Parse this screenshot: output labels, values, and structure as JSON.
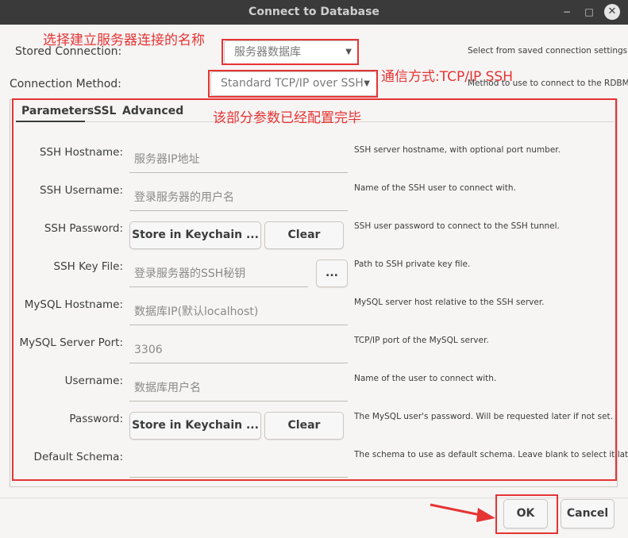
{
  "window": {
    "title": "Connect to Database",
    "minimize": "−",
    "maximize": "□",
    "close": "✕"
  },
  "stored_connection": {
    "label": "Stored Connection:",
    "value": "服务器数据库",
    "hint": "Select from saved connection settings"
  },
  "connection_method": {
    "label": "Connection Method:",
    "value": "Standard TCP/IP over SSH",
    "hint": "Method to use to connect to the RDBMS"
  },
  "annotations": {
    "name_note": "选择建立服务器连接的名称",
    "method_note": "通信方式:TCP/IP SSH",
    "params_note": "该部分参数已经配置完毕",
    "highlight_color": "#e53434"
  },
  "tabs": [
    "Parameters",
    "SSL",
    "Advanced"
  ],
  "fields": {
    "ssh_hostname": {
      "label": "SSH Hostname:",
      "value": "服务器IP地址",
      "hint": "SSH server hostname, with  optional port number."
    },
    "ssh_username": {
      "label": "SSH Username:",
      "value": "登录服务器的用户名",
      "hint": "Name of the SSH user to connect with."
    },
    "ssh_password": {
      "label": "SSH Password:",
      "store_label": "Store in Keychain ...",
      "clear_label": "Clear",
      "hint": "SSH user password to connect to the SSH tunnel."
    },
    "ssh_key_file": {
      "label": "SSH Key File:",
      "value": "登录服务器的SSH秘钥",
      "browse_label": "...",
      "hint": "Path to SSH private key file."
    },
    "mysql_hostname": {
      "label": "MySQL Hostname:",
      "value": "数据库IP(默认localhost)",
      "hint": "MySQL server host relative to the SSH server."
    },
    "mysql_port": {
      "label": "MySQL Server Port:",
      "value": "3306",
      "hint": "TCP/IP port of the MySQL server."
    },
    "username": {
      "label": "Username:",
      "value": "数据库用户名",
      "hint": "Name of the user to connect with."
    },
    "password": {
      "label": "Password:",
      "store_label": "Store in Keychain ...",
      "clear_label": "Clear",
      "hint": "The MySQL user's password. Will be requested later if not set."
    },
    "default_schema": {
      "label": "Default Schema:",
      "value": "",
      "hint": "The schema to use as default schema. Leave blank to select it later."
    }
  },
  "footer": {
    "ok_label": "OK",
    "cancel_label": "Cancel"
  }
}
